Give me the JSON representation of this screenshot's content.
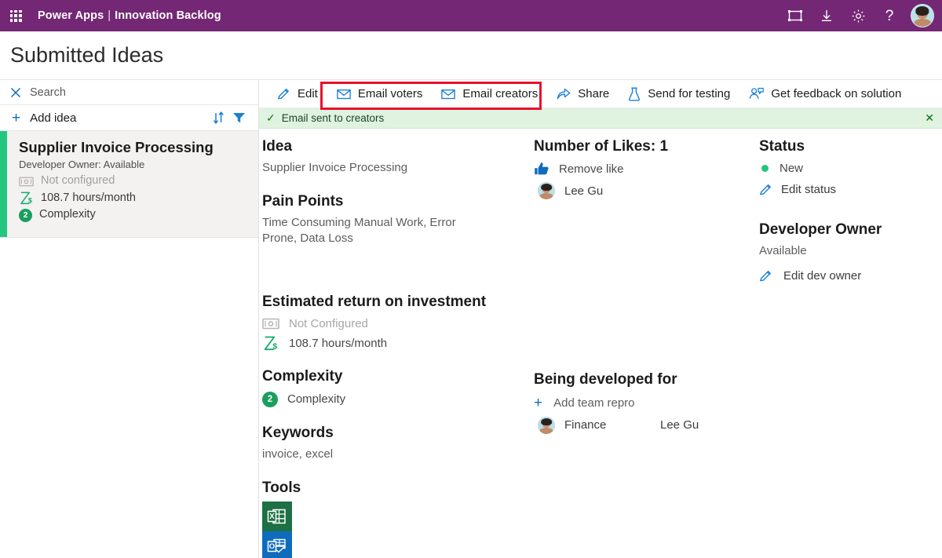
{
  "colors": {
    "brand_purple": "#742774",
    "accent_blue": "#0f6cbd",
    "green": "#22c67f",
    "badge_green": "#1a9e5e",
    "highlight_red": "#e8112d",
    "notification_bg": "#dff3e0",
    "excel_green": "#1d7044",
    "outlook_blue": "#0f6cbd"
  },
  "topbar": {
    "waffle_icon": "app-launcher-waffle-icon",
    "app_name": "Power Apps",
    "divider": "|",
    "page_name": "Innovation Backlog",
    "icons": [
      {
        "name": "fullscreen-icon",
        "glyph": "fullscreen"
      },
      {
        "name": "download-icon",
        "glyph": "download"
      },
      {
        "name": "settings-gear-icon",
        "glyph": "gear"
      },
      {
        "name": "help-icon",
        "glyph": "?"
      }
    ],
    "avatar_alt": "user-avatar"
  },
  "page": {
    "title": "Submitted Ideas"
  },
  "sidebar": {
    "search": {
      "icon": "close-icon",
      "label": "Search",
      "placeholder": "Search"
    },
    "add": {
      "icon": "plus-icon",
      "label": "Add idea"
    },
    "sort_icon": "sort-icon",
    "filter_icon": "filter-icon",
    "cards": [
      {
        "title": "Supplier Invoice Processing",
        "owner_line": "Developer Owner: Available",
        "roi_icon": "money-icon",
        "roi_label": "Not configured",
        "hours_icon": "hourglass-dollar-icon",
        "hours_label": "108.7 hours/month",
        "complexity_badge": "2",
        "complexity_label": "Complexity"
      }
    ]
  },
  "commandbar": {
    "items": [
      {
        "id": "edit",
        "label": "Edit",
        "icon": "pencil-icon",
        "highlighted": false
      },
      {
        "id": "email-voters",
        "label": "Email voters",
        "icon": "envelope-icon",
        "highlighted": true
      },
      {
        "id": "email-creators",
        "label": "Email creators",
        "icon": "envelope-icon",
        "highlighted": true
      },
      {
        "id": "share",
        "label": "Share",
        "icon": "share-icon",
        "highlighted": false
      },
      {
        "id": "send-for-testing",
        "label": "Send for testing",
        "icon": "flask-icon",
        "highlighted": false
      },
      {
        "id": "get-feedback",
        "label": "Get feedback on solution",
        "icon": "person-feedback-icon",
        "highlighted": false
      }
    ]
  },
  "notification": {
    "check_icon": "checkmark-icon",
    "message": "Email sent to creators",
    "close_icon": "close-icon"
  },
  "detail": {
    "idea": {
      "heading": "Idea",
      "value": "Supplier Invoice Processing"
    },
    "pain_points": {
      "heading": "Pain Points",
      "value": "Time Consuming Manual Work, Error Prone, Data Loss"
    },
    "roi": {
      "heading": "Estimated return on investment",
      "money_icon": "money-icon",
      "money_label": "Not Configured",
      "hours_icon": "hourglass-dollar-icon",
      "hours_label": "108.7 hours/month"
    },
    "complexity": {
      "heading": "Complexity",
      "badge": "2",
      "label": "Complexity"
    },
    "keywords": {
      "heading": "Keywords",
      "value": "invoice, excel"
    },
    "tools": {
      "heading": "Tools",
      "items": [
        {
          "name": "excel-tool-icon",
          "label": "Excel"
        },
        {
          "name": "outlook-tool-icon",
          "label": "Outlook"
        }
      ]
    },
    "likes": {
      "heading": "Number of Likes: 1",
      "action_icon": "thumbs-up-icon",
      "action_label": "Remove like",
      "voters": [
        {
          "name": "Lee Gu",
          "avatar": "user-avatar"
        }
      ]
    },
    "developed_for": {
      "heading": "Being developed for",
      "add_icon": "plus-icon",
      "add_label": "Add team repro",
      "rows": [
        {
          "avatar": "user-avatar",
          "team": "Finance",
          "person": "Lee Gu"
        }
      ]
    },
    "status": {
      "heading": "Status",
      "dot_icon": "status-dot-icon",
      "value": "New",
      "edit_icon": "pencil-icon",
      "edit_label": "Edit status"
    },
    "developer_owner": {
      "heading": "Developer Owner",
      "value": "Available",
      "edit_icon": "pencil-icon",
      "edit_label": "Edit dev owner"
    }
  }
}
